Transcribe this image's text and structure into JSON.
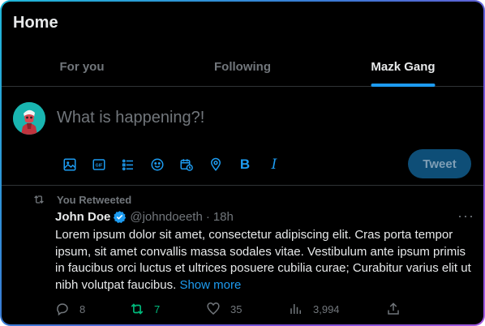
{
  "header": {
    "title": "Home"
  },
  "tabs": [
    {
      "label": "For you",
      "active": false
    },
    {
      "label": "Following",
      "active": false
    },
    {
      "label": "Mazk Gang",
      "active": true
    }
  ],
  "composer": {
    "placeholder": "What is happening?!",
    "tools": [
      "image-icon",
      "gif-icon",
      "poll-icon",
      "emoji-icon",
      "schedule-icon",
      "location-icon",
      "bold-icon",
      "italic-icon"
    ],
    "bold_label": "B",
    "italic_label": "I",
    "gif_label": "GIF",
    "tweet_button": "Tweet"
  },
  "post": {
    "retweet_context": "You Retweeted",
    "author_name": "John Doe",
    "handle": "@johndoeeth",
    "separator": "·",
    "time": "18h",
    "text": "Lorem ipsum dolor sit amet, consectetur adipiscing elit. Cras porta tempor ipsum, sit amet convallis massa sodales vitae. Vestibulum ante ipsum primis in faucibus orci luctus et ultrices posuere cubilia curae; Curabitur varius elit ut nibh volutpat faucibus.",
    "show_more": "Show more",
    "more_icon": "···",
    "stats": {
      "replies": "8",
      "retweets": "7",
      "likes": "35",
      "views": "3,994"
    }
  },
  "colors": {
    "accent": "#1d9bf0",
    "retweet": "#00ba7c",
    "muted": "#71767b",
    "background": "#000000"
  }
}
